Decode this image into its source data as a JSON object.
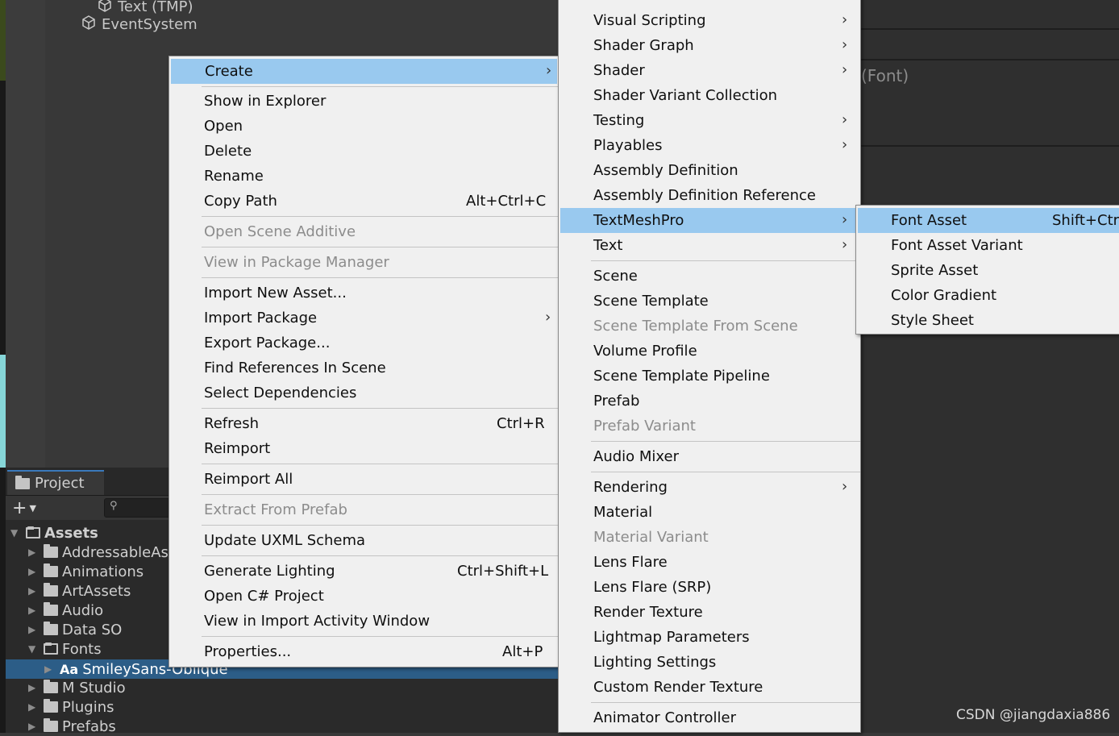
{
  "hierarchy": {
    "items": [
      "Text (TMP)",
      "EventSystem"
    ]
  },
  "inspector_partial_label": "(Font)",
  "project": {
    "tab_label": "Project",
    "add_label": "+",
    "tree": {
      "root": "Assets",
      "items": [
        "AddressableAs",
        "Animations",
        "ArtAssets",
        "Audio",
        "Data SO",
        "Fonts",
        "SmileySans-Oblique",
        "M Studio",
        "Plugins",
        "Prefabs"
      ],
      "font_file_prefix": "Aa"
    }
  },
  "menu1": {
    "create": "Create",
    "show_in_explorer": "Show in Explorer",
    "open": "Open",
    "delete": "Delete",
    "rename": "Rename",
    "copy_path": "Copy Path",
    "copy_path_shortcut": "Alt+Ctrl+C",
    "open_scene_additive": "Open Scene Additive",
    "view_in_package_manager": "View in Package Manager",
    "import_new_asset": "Import New Asset...",
    "import_package": "Import Package",
    "export_package": "Export Package...",
    "find_references": "Find References In Scene",
    "select_dependencies": "Select Dependencies",
    "refresh": "Refresh",
    "refresh_shortcut": "Ctrl+R",
    "reimport": "Reimport",
    "reimport_all": "Reimport All",
    "extract_from_prefab": "Extract From Prefab",
    "update_uxml": "Update UXML Schema",
    "generate_lighting": "Generate Lighting",
    "generate_lighting_shortcut": "Ctrl+Shift+L",
    "open_csharp": "Open C# Project",
    "view_import_activity": "View in Import Activity Window",
    "properties": "Properties...",
    "properties_shortcut": "Alt+P"
  },
  "menu2": {
    "visual_scripting": "Visual Scripting",
    "shader_graph": "Shader Graph",
    "shader": "Shader",
    "shader_variant_collection": "Shader Variant Collection",
    "testing": "Testing",
    "playables": "Playables",
    "assembly_definition": "Assembly Definition",
    "assembly_definition_reference": "Assembly Definition Reference",
    "textmeshpro": "TextMeshPro",
    "text": "Text",
    "scene": "Scene",
    "scene_template": "Scene Template",
    "scene_template_from_scene": "Scene Template From Scene",
    "volume_profile": "Volume Profile",
    "scene_template_pipeline": "Scene Template Pipeline",
    "prefab": "Prefab",
    "prefab_variant": "Prefab Variant",
    "audio_mixer": "Audio Mixer",
    "rendering": "Rendering",
    "material": "Material",
    "material_variant": "Material Variant",
    "lens_flare": "Lens Flare",
    "lens_flare_srp": "Lens Flare (SRP)",
    "render_texture": "Render Texture",
    "lightmap_parameters": "Lightmap Parameters",
    "lighting_settings": "Lighting Settings",
    "custom_render_texture": "Custom Render Texture",
    "animator_controller": "Animator Controller"
  },
  "menu3": {
    "font_asset": "Font Asset",
    "font_asset_shortcut": "Shift+Ctrl",
    "font_asset_variant": "Font Asset Variant",
    "sprite_asset": "Sprite Asset",
    "color_gradient": "Color Gradient",
    "style_sheet": "Style Sheet"
  },
  "watermark": "CSDN @jiangdaxia886",
  "colors": {
    "menu_bg": "#f0f0f0",
    "menu_highlight": "#99c9ef",
    "disabled_text": "#8c8c8c",
    "selection_row": "#2c5d87",
    "editor_bg": "#383838"
  }
}
